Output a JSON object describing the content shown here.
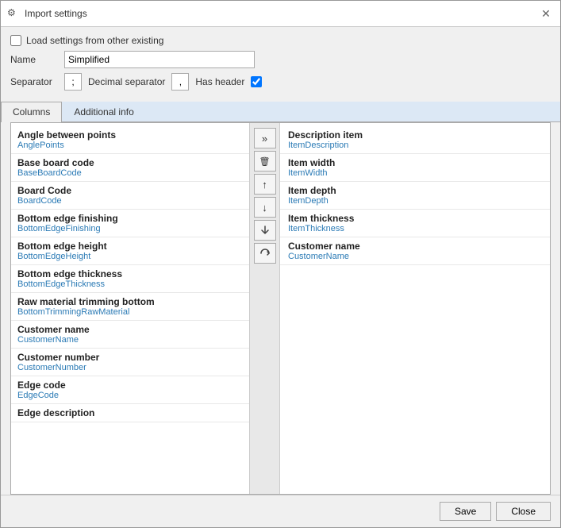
{
  "window": {
    "title": "Import settings",
    "title_icon": "⚙"
  },
  "header": {
    "load_settings_label": "Load settings from other existing",
    "name_label": "Name",
    "name_value": "Simplified",
    "separator_label": "Separator",
    "separator_value": ";",
    "decimal_label": "Decimal separator",
    "decimal_value": ",",
    "has_header_label": "Has header"
  },
  "tabs": [
    {
      "id": "columns",
      "label": "Columns",
      "active": true
    },
    {
      "id": "additional_info",
      "label": "Additional info",
      "active": false
    }
  ],
  "left_items": [
    {
      "title": "Angle between points",
      "sub": "AnglePoints"
    },
    {
      "title": "Base board code",
      "sub": "BaseBoardCode"
    },
    {
      "title": "Board Code",
      "sub": "BoardCode"
    },
    {
      "title": "Bottom edge finishing",
      "sub": "BottomEdgeFinishing"
    },
    {
      "title": "Bottom edge height",
      "sub": "BottomEdgeHeight"
    },
    {
      "title": "Bottom edge thickness",
      "sub": "BottomEdgeThickness"
    },
    {
      "title": "Raw material trimming bottom",
      "sub": "BottomTrimmingRawMaterial"
    },
    {
      "title": "Customer name",
      "sub": "CustomerName"
    },
    {
      "title": "Customer number",
      "sub": "CustomerNumber"
    },
    {
      "title": "Edge code",
      "sub": "EdgeCode"
    },
    {
      "title": "Edge description",
      "sub": ""
    }
  ],
  "middle_buttons": [
    {
      "id": "move-all-right",
      "symbol": "»"
    },
    {
      "id": "delete",
      "symbol": "🗑"
    },
    {
      "id": "move-up",
      "symbol": "↑"
    },
    {
      "id": "move-down",
      "symbol": "↓"
    },
    {
      "id": "move-bottom",
      "symbol": "⇓"
    },
    {
      "id": "sort",
      "symbol": "↺"
    }
  ],
  "right_items": [
    {
      "title": "Description item",
      "sub": "ItemDescription"
    },
    {
      "title": "Item width",
      "sub": "ItemWidth"
    },
    {
      "title": "Item depth",
      "sub": "ItemDepth"
    },
    {
      "title": "Item thickness",
      "sub": "ItemThickness"
    },
    {
      "title": "Customer name",
      "sub": "CustomerName"
    }
  ],
  "footer": {
    "save_label": "Save",
    "close_label": "Close"
  }
}
